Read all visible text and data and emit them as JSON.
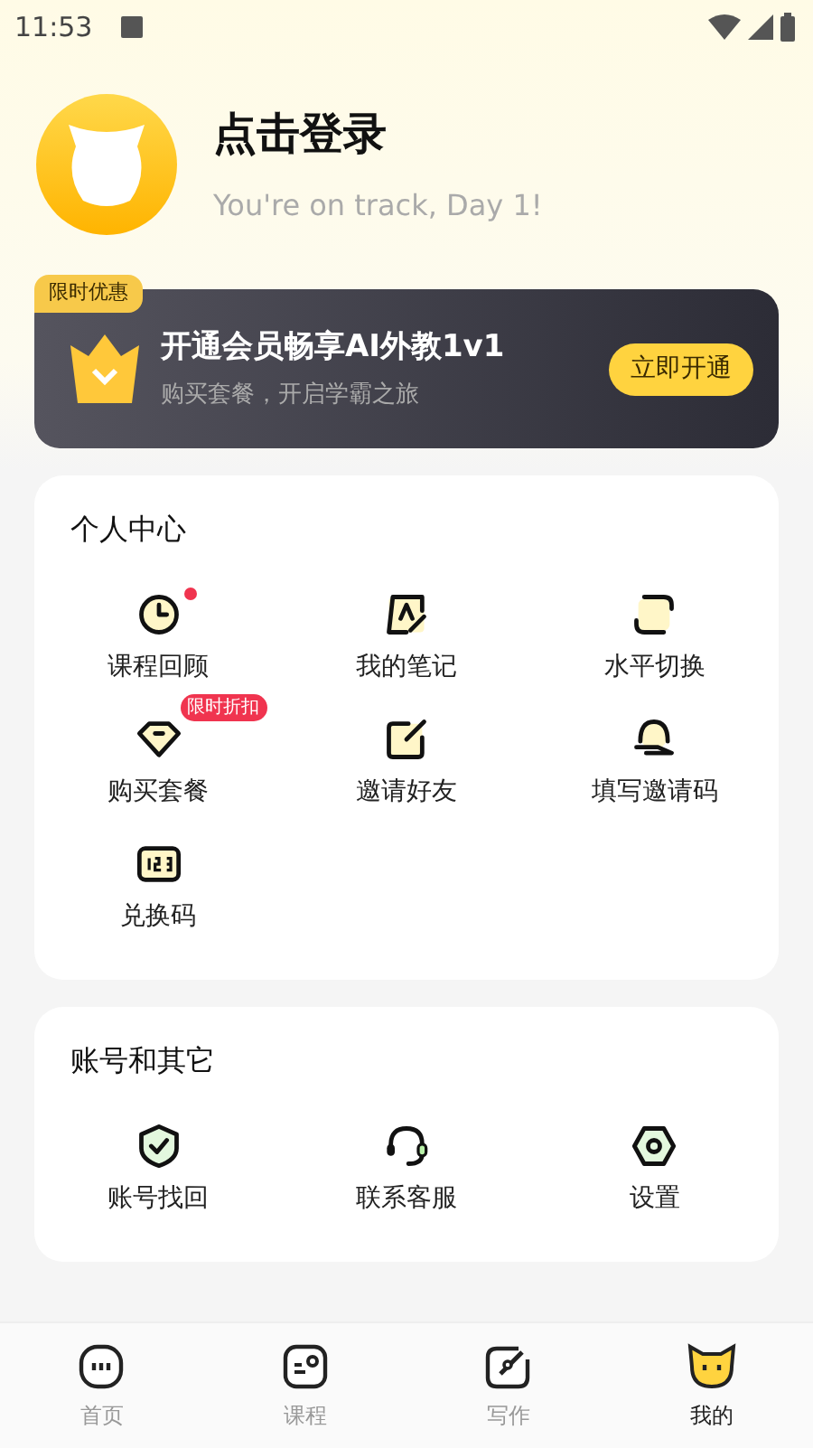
{
  "status_bar": {
    "time": "11:53"
  },
  "profile": {
    "title": "点击登录",
    "subtitle": "You're on track, Day 1!"
  },
  "promo": {
    "tag": "限时优惠",
    "title": "开通会员畅享AI外教1v1",
    "subtitle": "购买套餐，开启学霸之旅",
    "button": "立即开通"
  },
  "sections": [
    {
      "title": "个人中心",
      "items": [
        {
          "label": "课程回顾",
          "dot": true
        },
        {
          "label": "我的笔记",
          "dot": false
        },
        {
          "label": "水平切换",
          "dot": false
        },
        {
          "label": "购买套餐",
          "dot": false,
          "badge": "限时折扣"
        },
        {
          "label": "邀请好友",
          "dot": false
        },
        {
          "label": "填写邀请码",
          "dot": false
        },
        {
          "label": "兑换码",
          "dot": false
        }
      ]
    },
    {
      "title": "账号和其它",
      "items": [
        {
          "label": "账号找回",
          "dot": false
        },
        {
          "label": "联系客服",
          "dot": false
        },
        {
          "label": "设置",
          "dot": false
        }
      ]
    }
  ],
  "tabs": [
    {
      "label": "首页",
      "selected": false
    },
    {
      "label": "课程",
      "selected": false
    },
    {
      "label": "写作",
      "selected": false
    },
    {
      "label": "我的",
      "selected": true
    }
  ]
}
